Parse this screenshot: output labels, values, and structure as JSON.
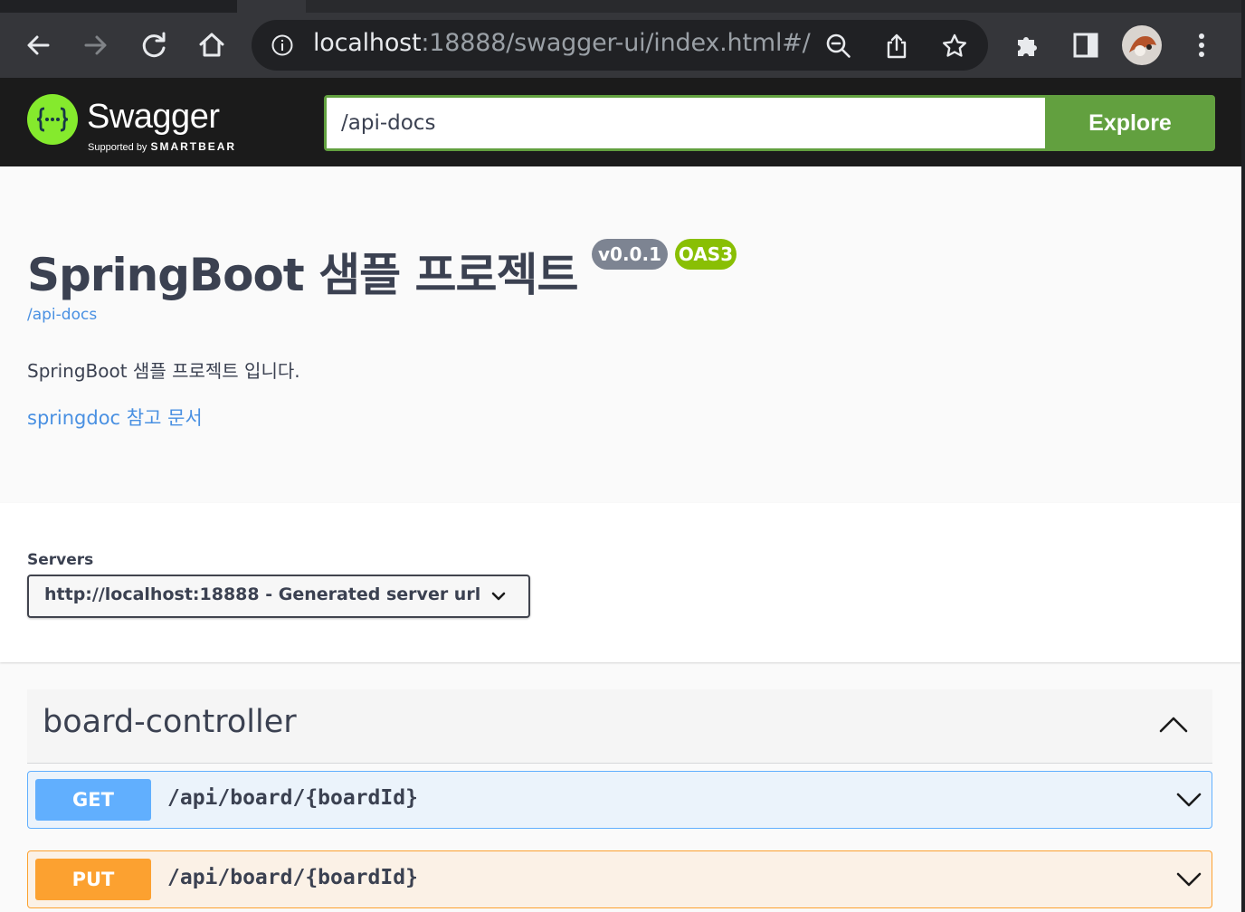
{
  "browser": {
    "url_host": "localhost",
    "url_rest": ":18888/swagger-ui/index.html#/"
  },
  "swagger": {
    "logo_text": "Swagger",
    "logo_sub": "Supported by",
    "logo_brand": "SMARTBEAR",
    "search_value": "/api-docs",
    "explore_label": "Explore",
    "accent_color": "#85ea2d"
  },
  "info": {
    "title": "SpringBoot 샘플 프로젝트",
    "version_badge": "v0.0.1",
    "oas_badge": "OAS3",
    "api_link": "/api-docs",
    "description": "SpringBoot 샘플 프로젝트 입니다.",
    "doc_link": "springdoc 참고 문서"
  },
  "servers": {
    "label": "Servers",
    "selected": "http://localhost:18888 - Generated server url"
  },
  "tag": {
    "name": "board-controller",
    "operations": [
      {
        "method": "GET",
        "path": "/api/board/{boardId}",
        "color": "#61affe"
      },
      {
        "method": "PUT",
        "path": "/api/board/{boardId}",
        "color": "#fca130"
      }
    ]
  }
}
